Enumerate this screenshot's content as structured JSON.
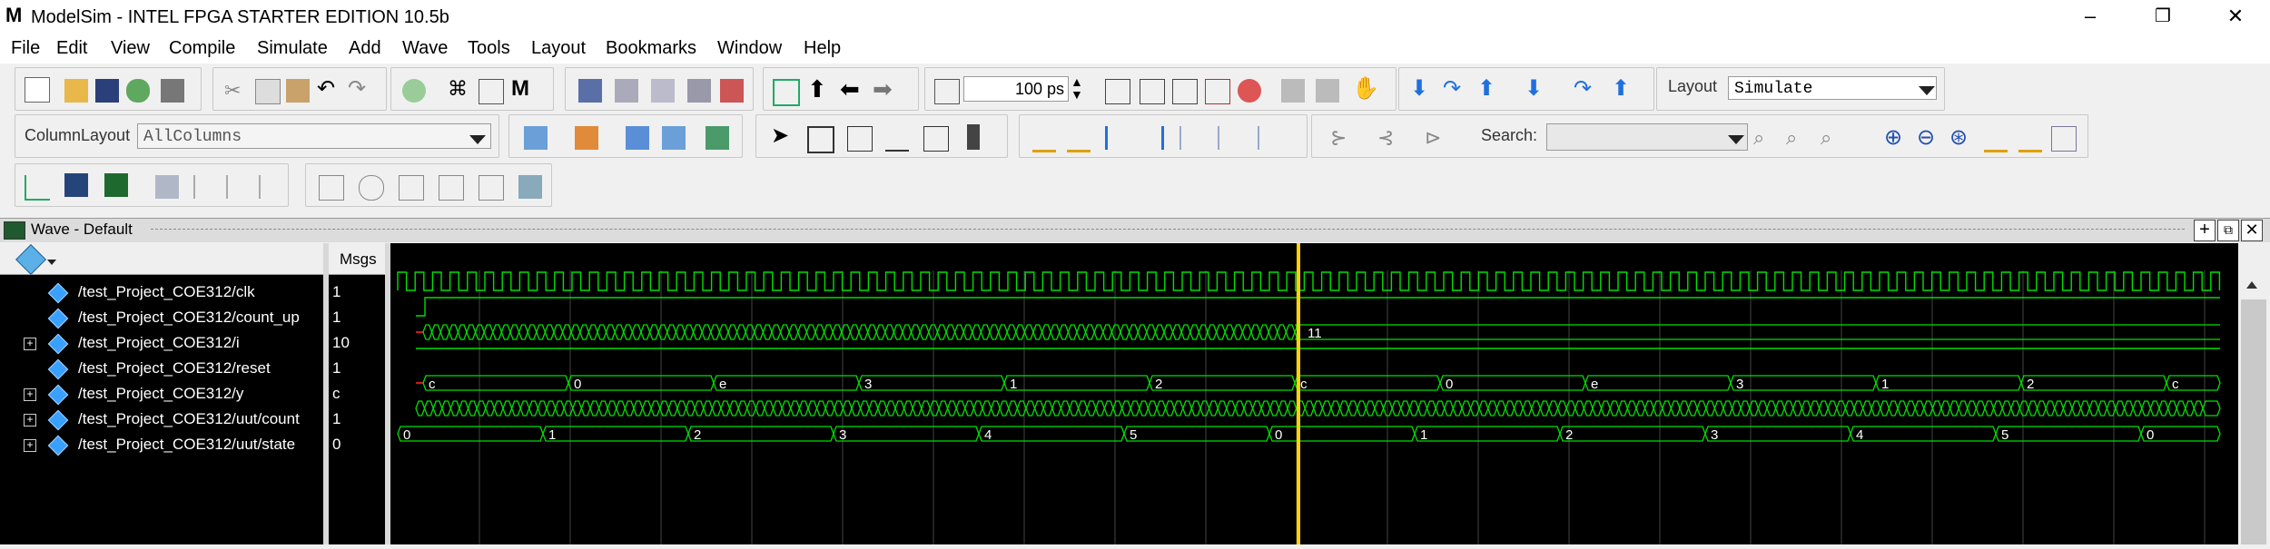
{
  "window": {
    "title": "ModelSim - INTEL FPGA STARTER EDITION 10.5b",
    "logo": "M",
    "minimize": "–",
    "restore": "❐",
    "close": "✕"
  },
  "menu": [
    "File",
    "Edit",
    "View",
    "Compile",
    "Simulate",
    "Add",
    "Wave",
    "Tools",
    "Layout",
    "Bookmarks",
    "Window",
    "Help"
  ],
  "toolbar": {
    "time_step_value": "100 ps",
    "layout_label": "Layout",
    "layout_value": "Simulate",
    "column_layout_label": "ColumnLayout",
    "column_layout_value": "AllColumns",
    "search_label": "Search:",
    "search_value": ""
  },
  "wave_window": {
    "title": "Wave - Default",
    "msgs_header": "Msgs",
    "signals": [
      {
        "name": "/test_Project_COE312/clk",
        "value": "1",
        "expandable": false
      },
      {
        "name": "/test_Project_COE312/count_up",
        "value": "1",
        "expandable": false
      },
      {
        "name": "/test_Project_COE312/i",
        "value": "10",
        "expandable": true
      },
      {
        "name": "/test_Project_COE312/reset",
        "value": "1",
        "expandable": false
      },
      {
        "name": "/test_Project_COE312/y",
        "value": "c",
        "expandable": true
      },
      {
        "name": "/test_Project_COE312/uut/count",
        "value": "1",
        "expandable": true
      },
      {
        "name": "/test_Project_COE312/uut/state",
        "value": "0",
        "expandable": true
      }
    ],
    "cursor_i_value": "11",
    "y_labels": [
      "c",
      "0",
      "e",
      "3",
      "1",
      "2",
      "c",
      "0",
      "e",
      "3",
      "1",
      "2",
      "c"
    ],
    "state_labels": [
      "0",
      "1",
      "2",
      "3",
      "4",
      "5",
      "0",
      "1",
      "2",
      "3",
      "4",
      "5",
      "0"
    ]
  }
}
